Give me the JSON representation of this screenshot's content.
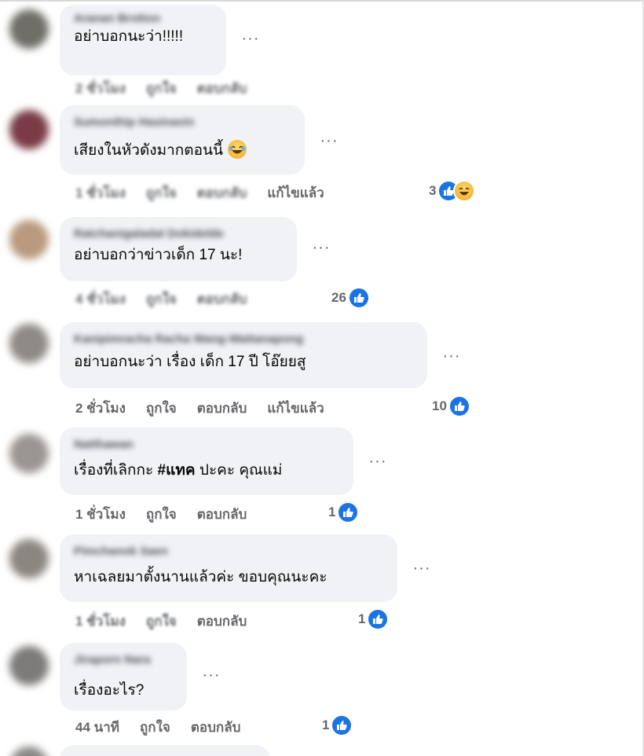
{
  "colors": {
    "bubble_bg": "#f0f2f5",
    "meta_text": "#65676b",
    "like_blue": "#1b74e4"
  },
  "comments": [
    {
      "author": "Aranan Brotton",
      "text": "อย่าบอกนะว่า!!!!!",
      "time": "2 ชั่วโมง",
      "like_label": "ถูกใจ",
      "reply_label": "ตอบกลับ",
      "edited": "",
      "reactions": ""
    },
    {
      "author": "Sumonthip Hasinavin",
      "text": "เสียงในหัวดังมากตอนนี้",
      "emoji": "laugh-emoji",
      "time": "1 ชั่วโมง",
      "like_label": "ถูกใจ",
      "reply_label": "ตอบกลับ",
      "edited": "แก้ไขแล้ว",
      "reactions": "3"
    },
    {
      "author": "Ratchanigaladal Dokidelde",
      "text": "อย่าบอกว่าข่าวเด็ก 17 นะ!",
      "time": "4 ชั่วโมง",
      "like_label": "ถูกใจ",
      "reply_label": "ตอบกลับ",
      "edited": "",
      "reactions": "26"
    },
    {
      "author": "Kanipimracha Racha Wang-Wattanapong",
      "text": "อย่าบอกนะว่า เรื่อง เด็ก 17 ปี โอ๊ยยสู",
      "time": "2 ชั่วโมง",
      "like_label": "ถูกใจ",
      "reply_label": "ตอบกลับ",
      "edited": "แก้ไขแล้ว",
      "reactions": "10"
    },
    {
      "author": "Natthawan",
      "text_pre": "เรื่องที่เลิกกะ ",
      "tag": "#แทค",
      "text_post": " ปะคะ คุณแม่",
      "time": "1 ชั่วโมง",
      "like_label": "ถูกใจ",
      "reply_label": "ตอบกลับ",
      "edited": "",
      "reactions": "1"
    },
    {
      "author": "Pimchanok Saen",
      "text": "หาเฉลยมาตั้งนานแล้วค่ะ ขอบคุณนะคะ",
      "time": "1 ชั่วโมง",
      "like_label": "ถูกใจ",
      "reply_label": "ตอบกลับ",
      "edited": "",
      "reactions": "1"
    },
    {
      "author": "Jiraporn Nara",
      "text": "เรื่องอะไร?",
      "time": "44 นาที",
      "like_label": "ถูกใจ",
      "reply_label": "ตอบกลับ",
      "edited": "",
      "reactions": "1"
    }
  ]
}
